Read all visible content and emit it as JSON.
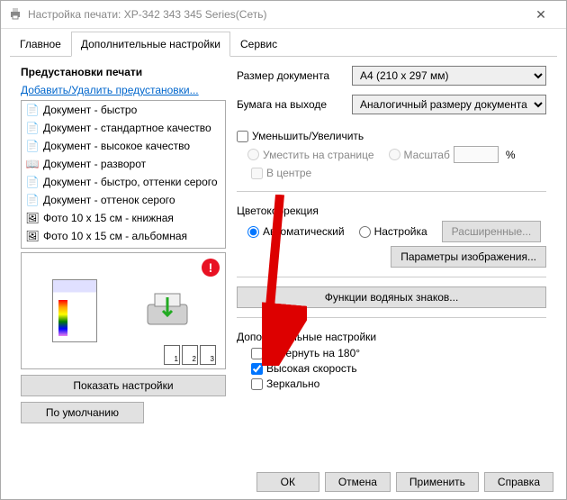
{
  "window": {
    "title": "Настройка печати: XP-342 343 345 Series(Сеть)"
  },
  "tabs": {
    "main": "Главное",
    "more": "Дополнительные настройки",
    "service": "Сервис"
  },
  "presets": {
    "title": "Предустановки печати",
    "add_remove": "Добавить/Удалить предустановки...",
    "items": [
      {
        "label": "Документ - быстро"
      },
      {
        "label": "Документ - стандартное качество"
      },
      {
        "label": "Документ - высокое качество"
      },
      {
        "label": "Документ - разворот"
      },
      {
        "label": "Документ - быстро, оттенки серого"
      },
      {
        "label": "Документ - оттенок серого"
      },
      {
        "label": "Фото 10 x 15 см - книжная"
      },
      {
        "label": "Фото 10 x 15 см - альбомная"
      }
    ],
    "show_settings": "Показать настройки",
    "defaults": "По умолчанию"
  },
  "doc_size": {
    "label": "Размер документа",
    "value": "A4 (210 x 297 мм)"
  },
  "output_paper": {
    "label": "Бумага на выходе",
    "value": "Аналогичный размеру документа"
  },
  "reduce": {
    "label": "Уменьшить/Увеличить",
    "fit_page": "Уместить на странице",
    "scale": "Масштаб",
    "scale_value": "",
    "percent": "%",
    "center": "В центре"
  },
  "color": {
    "title": "Цветокоррекция",
    "auto": "Автоматический",
    "custom": "Настройка",
    "advanced": "Расширенные...",
    "image_params": "Параметры изображения..."
  },
  "watermark": {
    "label": "Функции водяных знаков..."
  },
  "additional": {
    "title": "Дополнительные настройки",
    "rotate": "Повернуть на 180°",
    "high_speed": "Высокая скорость",
    "mirror": "Зеркально"
  },
  "buttons": {
    "ok": "ОК",
    "cancel": "Отмена",
    "apply": "Применить",
    "help": "Справка"
  }
}
